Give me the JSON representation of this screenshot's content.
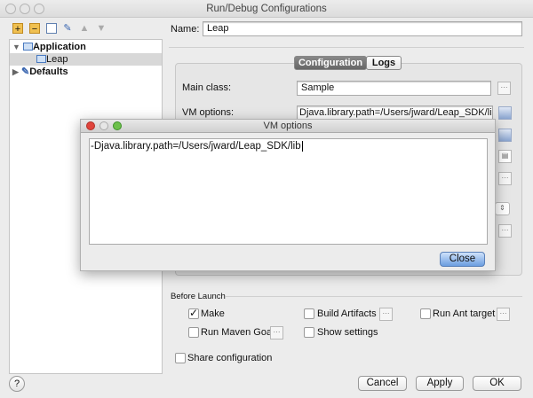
{
  "window": {
    "title": "Run/Debug Configurations"
  },
  "toolbar": {
    "icons": [
      "add-icon",
      "remove-icon",
      "copy-icon",
      "edit-defaults-icon",
      "move-up-icon",
      "move-down-icon"
    ]
  },
  "tree": {
    "items": [
      {
        "label": "Application",
        "expanded": true
      },
      {
        "label": "Leap",
        "selected": true
      },
      {
        "label": "Defaults",
        "expanded": false
      }
    ]
  },
  "name": {
    "label": "Name:",
    "value": "Leap"
  },
  "tabs": [
    {
      "label": "Configuration",
      "active": true
    },
    {
      "label": "Logs",
      "active": false
    }
  ],
  "form": {
    "main_class_label": "Main class:",
    "main_class_value": "Sample",
    "vm_options_label": "VM options:",
    "vm_options_value": "Djava.library.path=/Users/jward/Leap_SDK/lib"
  },
  "vm_dialog": {
    "title": "VM options",
    "text": "-Djava.library.path=/Users/jward/Leap_SDK/lib",
    "close_label": "Close"
  },
  "before_launch": {
    "label": "Before Launch",
    "options": [
      {
        "label": "Make",
        "checked": true
      },
      {
        "label": "Build Artifacts",
        "checked": false
      },
      {
        "label": "Run Ant target",
        "checked": false
      },
      {
        "label": "Run Maven Goal",
        "checked": false
      },
      {
        "label": "Show settings",
        "checked": false
      }
    ]
  },
  "share": {
    "label": "Share configuration",
    "checked": false
  },
  "buttons": {
    "help": "?",
    "cancel": "Cancel",
    "apply": "Apply",
    "ok": "OK"
  },
  "colors": {
    "accent": "#6b9ee0",
    "selected_row": "#d8d8d8"
  }
}
